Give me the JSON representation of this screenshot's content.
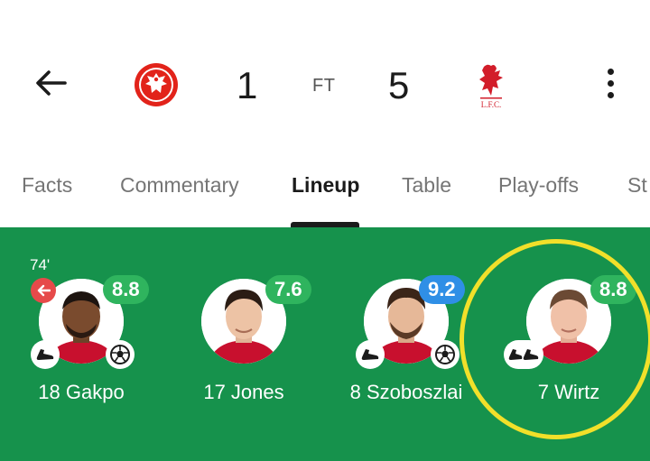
{
  "match": {
    "home_score": "1",
    "away_score": "5",
    "status": "FT",
    "home_crest_icon": "eintracht-frankfurt-crest-icon",
    "away_crest_icon": "liverpool-crest-icon",
    "away_crest_text": "L.F.C."
  },
  "tabs": [
    {
      "label": "Facts"
    },
    {
      "label": "Commentary"
    },
    {
      "label": "Lineup",
      "active": true
    },
    {
      "label": "Table"
    },
    {
      "label": "Play-offs"
    },
    {
      "label": "St"
    }
  ],
  "players": [
    {
      "name": "18 Gakpo",
      "rating": "8.8",
      "rating_color": "#2fb45e",
      "sub_time": "74'",
      "boot_icon": true,
      "goal_icon": true
    },
    {
      "name": "17 Jones",
      "rating": "7.6",
      "rating_color": "#2fb45e"
    },
    {
      "name": "8 Szoboszlai",
      "rating": "9.2",
      "rating_color": "#2f8fe6",
      "boot_icon": true,
      "goal_icon": true
    },
    {
      "name": "7 Wirtz",
      "rating": "8.8",
      "rating_color": "#2fb45e",
      "double_boot_icon": true
    }
  ],
  "colors": {
    "pitch": "#16924c",
    "highlight": "#f1e02a"
  }
}
